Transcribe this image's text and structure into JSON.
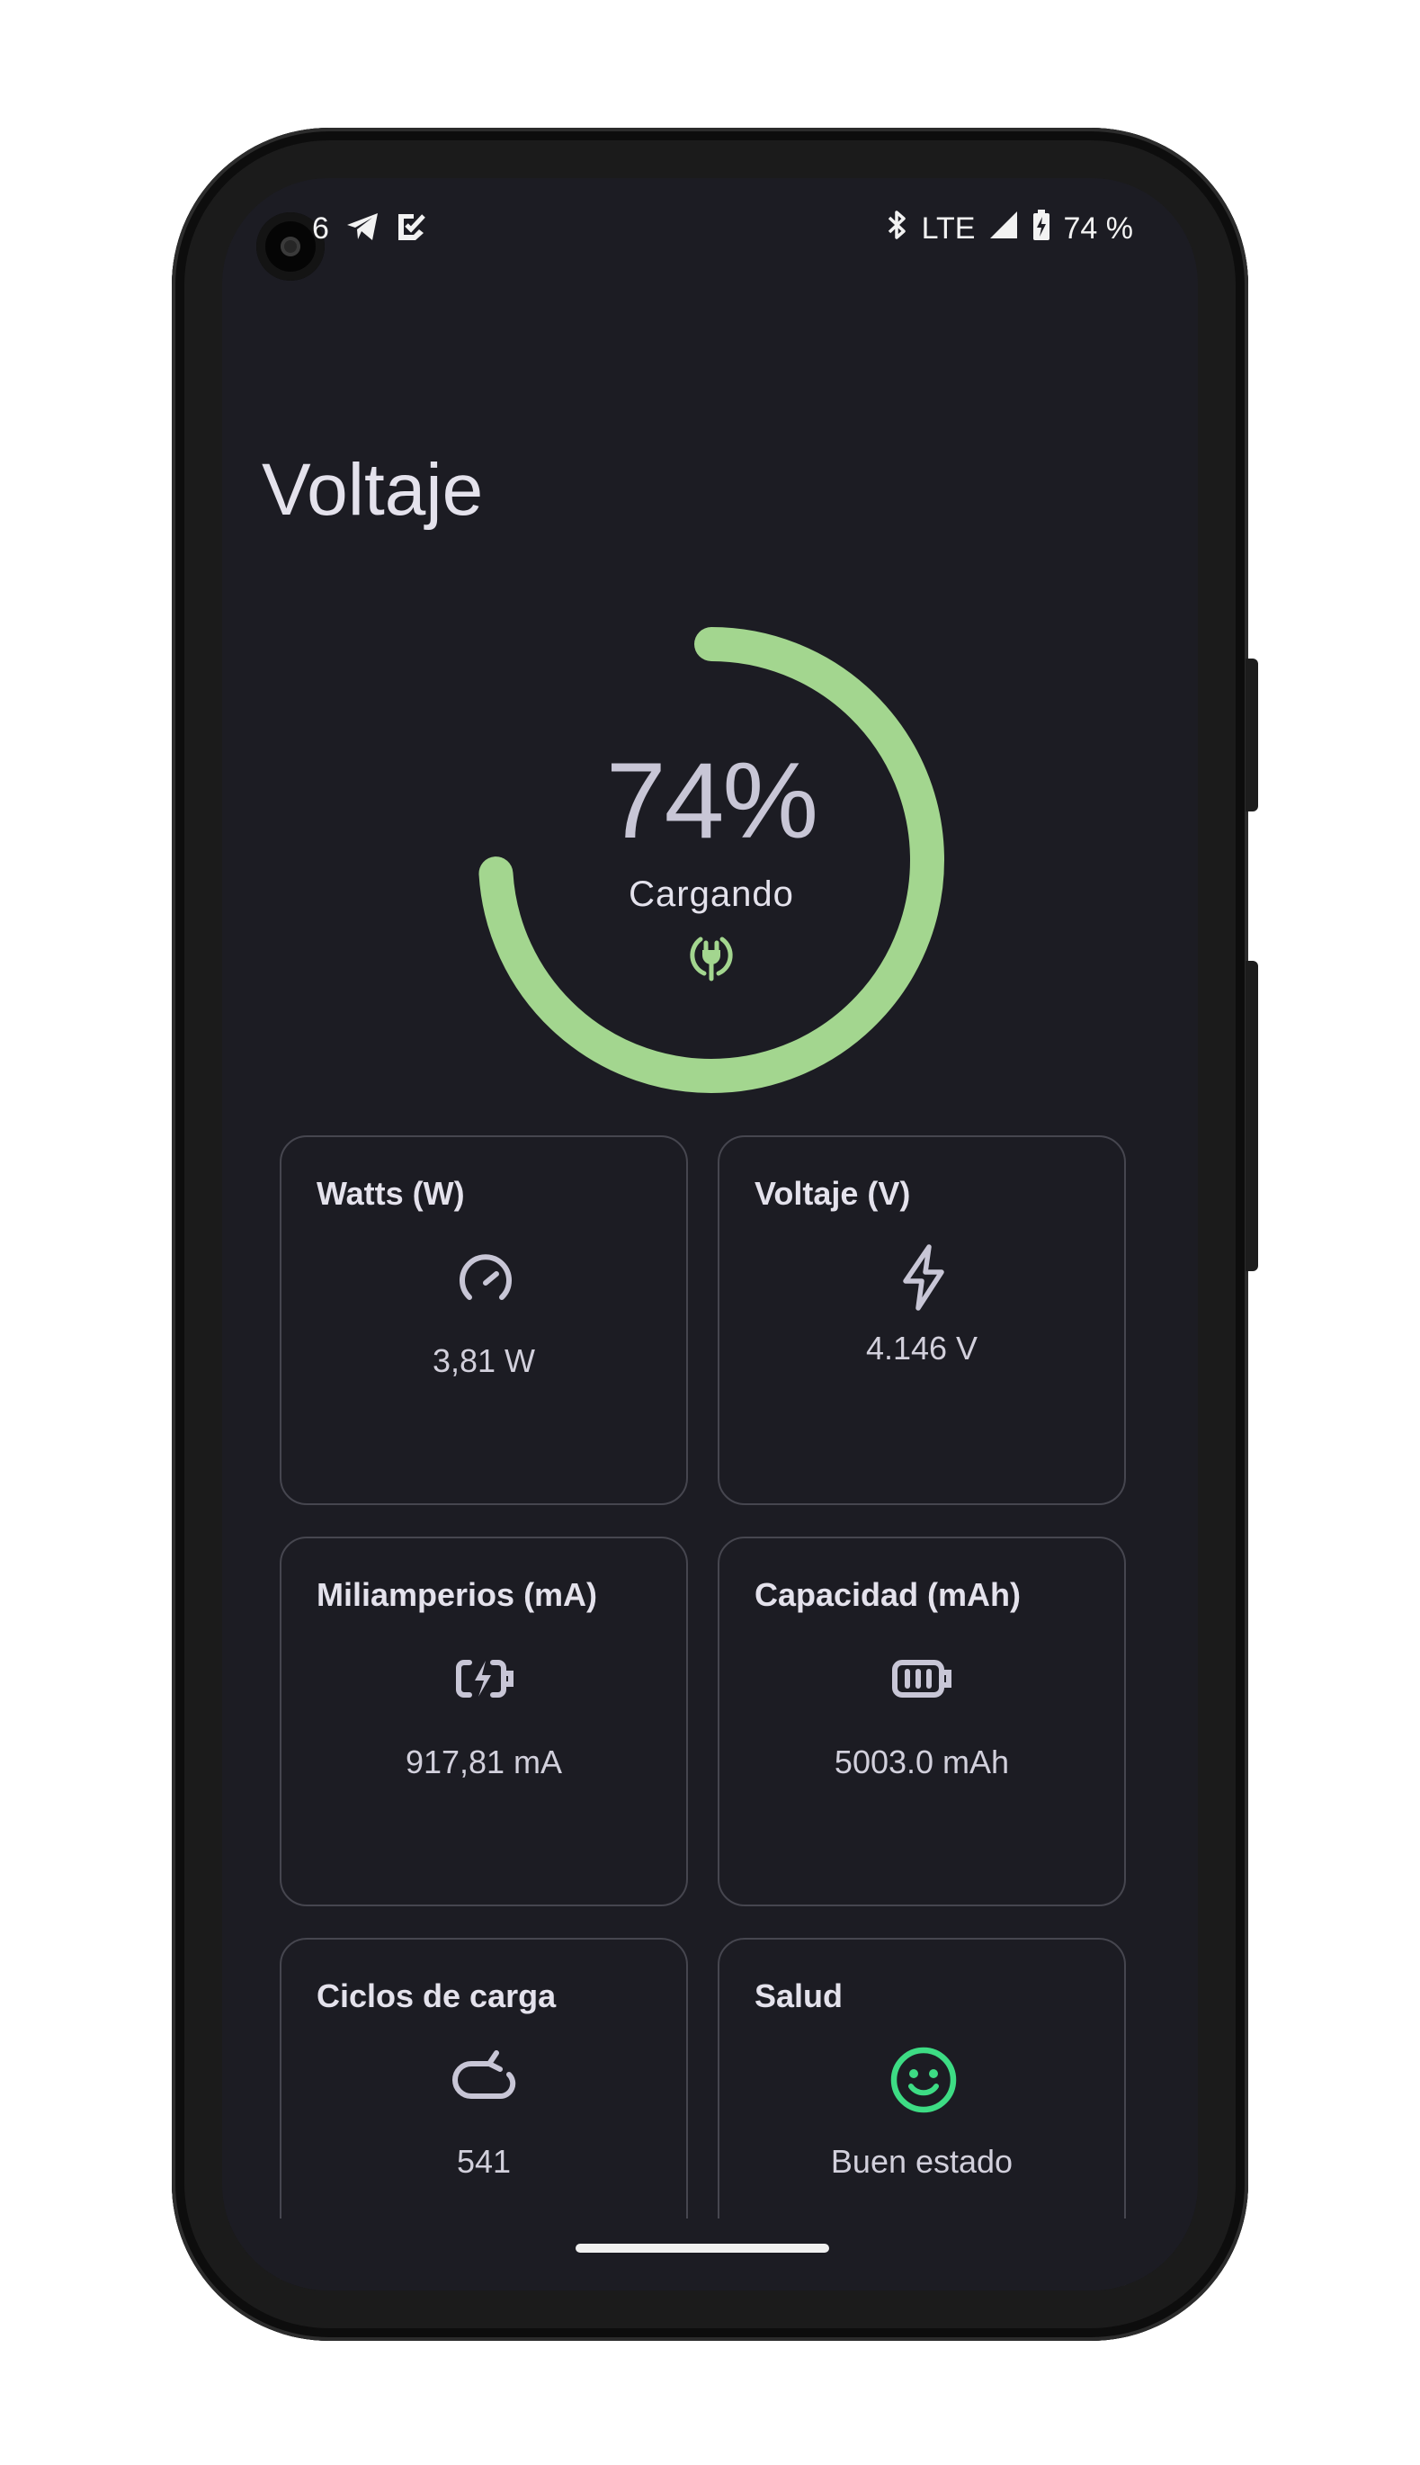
{
  "status_bar": {
    "time": "6",
    "network": "LTE",
    "battery_text": "74 %",
    "left_icons": [
      "telegram-icon",
      "checkbox-app-icon"
    ],
    "right_icons": [
      "bluetooth-icon",
      "signal-icon",
      "battery-charging-icon"
    ]
  },
  "page": {
    "title": "Voltaje"
  },
  "battery_ring": {
    "percent_text": "74%",
    "level": 0.74,
    "status": "Cargando",
    "icon": "plug-charging-icon",
    "color": "#a3d68f"
  },
  "cards": {
    "watts": {
      "title": "Watts (W)",
      "value": "3,81 W",
      "icon": "speedometer-icon"
    },
    "voltage": {
      "title": "Voltaje (V)",
      "value": "4.146 V",
      "icon": "bolt-icon"
    },
    "current": {
      "title": "Miliamperios (mA)",
      "value": "917,81 mA",
      "icon": "battery-bolt-icon"
    },
    "capacity": {
      "title": "Capacidad (mAh)",
      "value": "5003.0 mAh",
      "icon": "battery-full-icon"
    },
    "cycles": {
      "title": "Ciclos de carga",
      "value": "541",
      "icon": "cycle-arrow-icon"
    },
    "health": {
      "title": "Salud",
      "value": "Buen estado",
      "icon": "smiley-face-icon",
      "icon_color": "#3ddc84"
    }
  },
  "colors": {
    "background": "#1c1c23",
    "card_border": "#46464f",
    "accent_green": "#a3d68f",
    "health_green": "#3ddc84"
  }
}
